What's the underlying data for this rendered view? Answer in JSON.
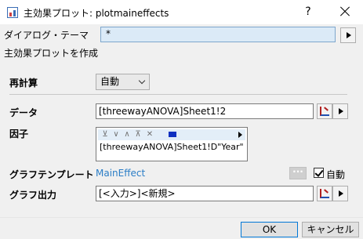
{
  "window": {
    "title": "主効果プロット: plotmaineffects",
    "help_label": "?"
  },
  "theme": {
    "label": "ダイアログ・テーマ",
    "value": "*"
  },
  "section": {
    "title": "主効果プロットを作成"
  },
  "recalc": {
    "label": "再計算",
    "selected": "自動"
  },
  "data": {
    "label": "データ",
    "value": "[threewayANOVA]Sheet1!2"
  },
  "factor": {
    "label": "因子",
    "toolbar_icons": [
      "move-bottom-icon",
      "move-down-icon",
      "move-up-icon",
      "move-top-icon",
      "delete-icon",
      "select-icon",
      "expand-icon"
    ],
    "items": [
      "[threewayANOVA]Sheet1!D\"Year\""
    ]
  },
  "template": {
    "label": "グラフテンプレート",
    "value": "MainEffect",
    "browse_label": "···",
    "auto_label": "自動",
    "auto_checked": true
  },
  "output": {
    "label": "グラフ出力",
    "value": "[<入力>]<新規>"
  },
  "buttons": {
    "ok": "OK",
    "cancel": "キャンセル"
  },
  "colors": {
    "link": "#2a7dc6",
    "accent": "#0078d7",
    "theme_field_bg": "#dbeaf7"
  }
}
